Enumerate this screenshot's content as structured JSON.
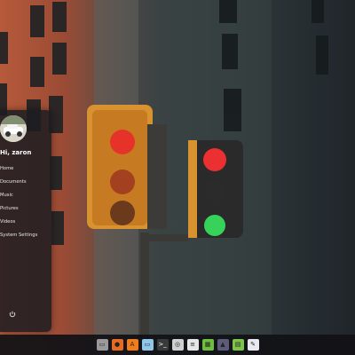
{
  "user_menu": {
    "greeting": "Hi, zaron",
    "items": [
      {
        "label": "Home"
      },
      {
        "label": "Documents"
      },
      {
        "label": "Music"
      },
      {
        "label": "Pictures"
      },
      {
        "label": "Videos"
      },
      {
        "label": "System Settings"
      }
    ],
    "power_icon": "power-icon"
  },
  "taskbar": {
    "icons": [
      {
        "name": "file-manager-icon",
        "color": "#9a9a9a",
        "glyph": "▭"
      },
      {
        "name": "firefox-icon",
        "color": "#e86a1f",
        "glyph": "●"
      },
      {
        "name": "software-manager-icon",
        "color": "#f07c1a",
        "glyph": "A"
      },
      {
        "name": "image-viewer-icon",
        "color": "#8fc7ea",
        "glyph": "▭"
      },
      {
        "name": "terminal-icon",
        "color": "#3a3a3a",
        "glyph": ">_"
      },
      {
        "name": "settings-icon",
        "color": "#d0d0d0",
        "glyph": "◎"
      },
      {
        "name": "text-editor-icon",
        "color": "#e6e6e6",
        "glyph": "≡"
      },
      {
        "name": "spreadsheet-icon",
        "color": "#6fbf3f",
        "glyph": "▦"
      },
      {
        "name": "store-icon",
        "color": "#5c5c7a",
        "glyph": "▲"
      },
      {
        "name": "calc-icon",
        "color": "#7cc44a",
        "glyph": "▤"
      },
      {
        "name": "notes-icon",
        "color": "#e8e8f0",
        "glyph": "✎"
      }
    ]
  }
}
